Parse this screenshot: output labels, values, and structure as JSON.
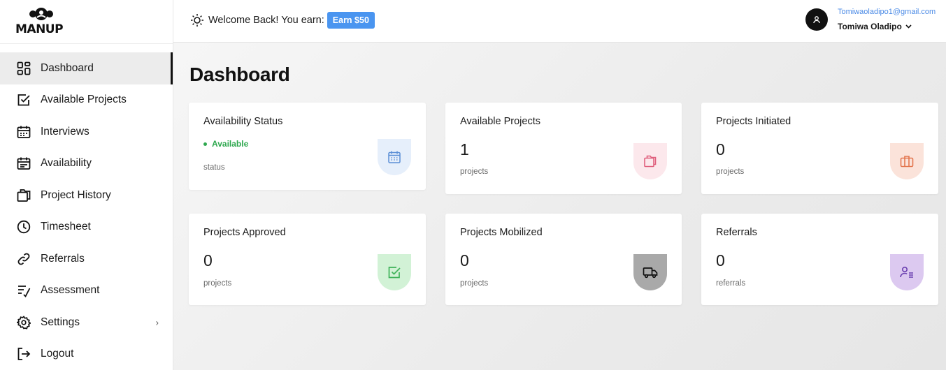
{
  "brand": {
    "logo_text": "MANUP"
  },
  "header": {
    "welcome_text": "Welcome Back! You earn:",
    "earn_badge": "Earn $50",
    "user_email": "Tomiwaoladipo1@gmail.com",
    "user_name": "Tomiwa Oladipo"
  },
  "sidebar": {
    "items": [
      {
        "label": "Dashboard",
        "icon": "grid-icon",
        "active": true
      },
      {
        "label": "Available Projects",
        "icon": "checkbox-icon"
      },
      {
        "label": "Interviews",
        "icon": "calendar-icon"
      },
      {
        "label": "Availability",
        "icon": "calendar-icon"
      },
      {
        "label": "Project History",
        "icon": "folders-icon"
      },
      {
        "label": "Timesheet",
        "icon": "clock-icon"
      },
      {
        "label": "Referrals",
        "icon": "link-icon"
      },
      {
        "label": "Assessment",
        "icon": "checklist-icon"
      },
      {
        "label": "Settings",
        "icon": "gear-icon",
        "has_submenu": true
      },
      {
        "label": "Logout",
        "icon": "logout-icon"
      }
    ]
  },
  "main": {
    "title": "Dashboard",
    "cards": [
      {
        "title": "Availability Status",
        "status": "Available",
        "unit": "status",
        "icon": "calendar-icon",
        "icon_color": "#5b8fd6",
        "icon_bg": "#e6effb"
      },
      {
        "title": "Available Projects",
        "value": "1",
        "unit": "projects",
        "icon": "folders-icon",
        "icon_color": "#e0607e",
        "icon_bg": "#fce8ec"
      },
      {
        "title": "Projects Initiated",
        "value": "0",
        "unit": "projects",
        "icon": "briefcase-icon",
        "icon_color": "#e3764f",
        "icon_bg": "#fbe3da"
      },
      {
        "title": "Projects Approved",
        "value": "0",
        "unit": "projects",
        "icon": "check-square-icon",
        "icon_color": "#3fb35a",
        "icon_bg": "#d2f2d6"
      },
      {
        "title": "Projects Mobilized",
        "value": "0",
        "unit": "projects",
        "icon": "truck-icon",
        "icon_color": "#111111",
        "icon_bg": "#a9a9a9"
      },
      {
        "title": "Referrals",
        "value": "0",
        "unit": "referrals",
        "icon": "user-list-icon",
        "icon_color": "#6a3fb0",
        "icon_bg": "#dcc9f0"
      }
    ]
  }
}
